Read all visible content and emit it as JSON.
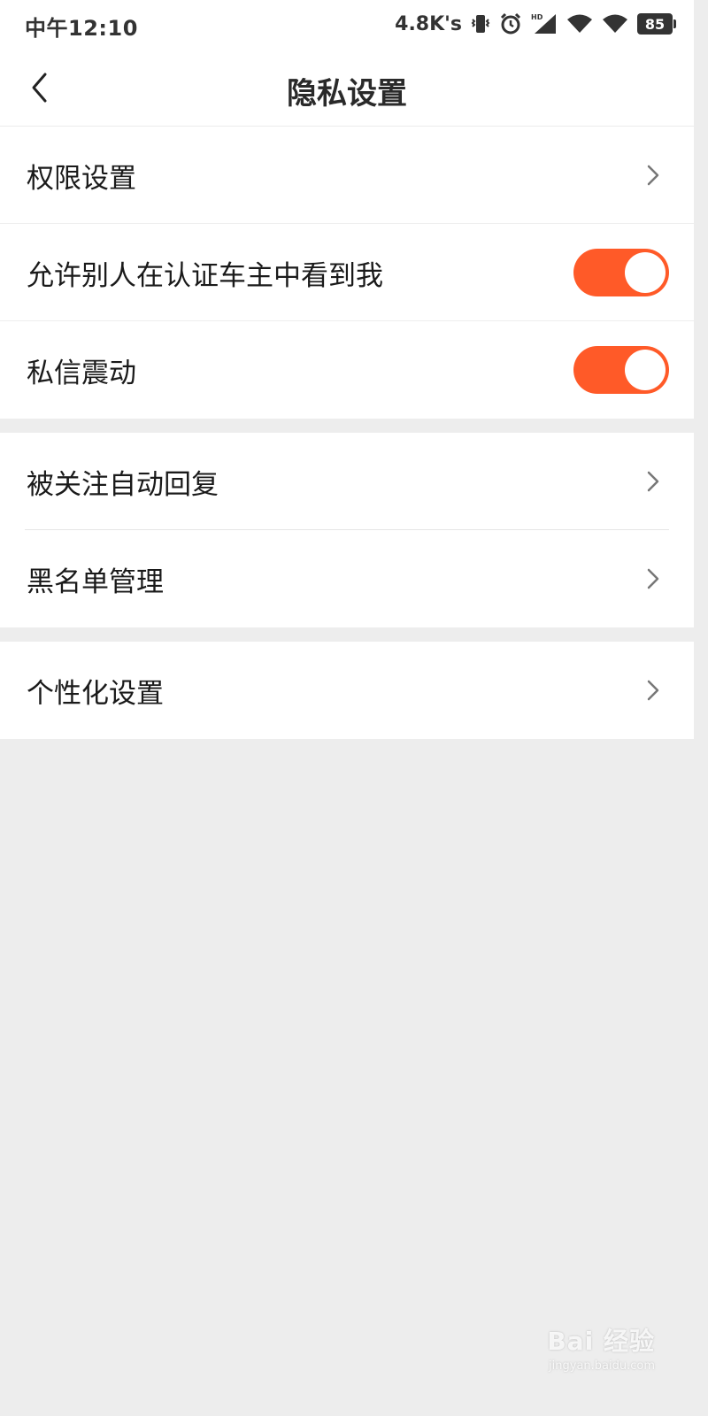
{
  "status_bar": {
    "time": "中午12:10",
    "net_speed": "4.8K's",
    "battery": "85",
    "hd_label": "HD"
  },
  "nav": {
    "title": "隐私设置"
  },
  "groups": [
    {
      "items": [
        {
          "label": "权限设置",
          "control": "chevron"
        },
        {
          "label": "允许别人在认证车主中看到我",
          "control": "toggle",
          "toggle_on": true
        },
        {
          "label": "私信震动",
          "control": "toggle",
          "toggle_on": true
        }
      ]
    },
    {
      "items": [
        {
          "label": "被关注自动回复",
          "control": "chevron"
        },
        {
          "label": "黑名单管理",
          "control": "chevron"
        }
      ]
    },
    {
      "items": [
        {
          "label": "个性化设置",
          "control": "chevron"
        }
      ]
    }
  ],
  "colors": {
    "accent": "#ff5a28",
    "background": "#ededed",
    "surface": "#ffffff"
  },
  "watermark": {
    "logo": "Bai 经验",
    "url": "jingyan.baidu.com"
  }
}
